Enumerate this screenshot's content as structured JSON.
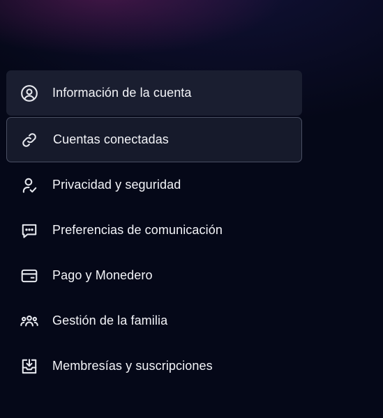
{
  "menu": {
    "items": [
      {
        "label": "Información de la cuenta",
        "icon": "user-circle-icon",
        "state": "hover"
      },
      {
        "label": "Cuentas conectadas",
        "icon": "link-icon",
        "state": "selected"
      },
      {
        "label": "Privacidad y seguridad",
        "icon": "user-check-icon",
        "state": "normal"
      },
      {
        "label": "Preferencias de comunicación",
        "icon": "chat-bubble-icon",
        "state": "normal"
      },
      {
        "label": "Pago y Monedero",
        "icon": "wallet-icon",
        "state": "normal"
      },
      {
        "label": "Gestión de la familia",
        "icon": "family-group-icon",
        "state": "normal"
      },
      {
        "label": "Membresías y suscripciones",
        "icon": "download-tray-icon",
        "state": "normal"
      }
    ]
  },
  "colors": {
    "background": "#050818",
    "item_hover": "#1a1e30",
    "item_selected": "#161a2b",
    "selected_border": "#4a4f63",
    "text": "#f3f4f8"
  }
}
